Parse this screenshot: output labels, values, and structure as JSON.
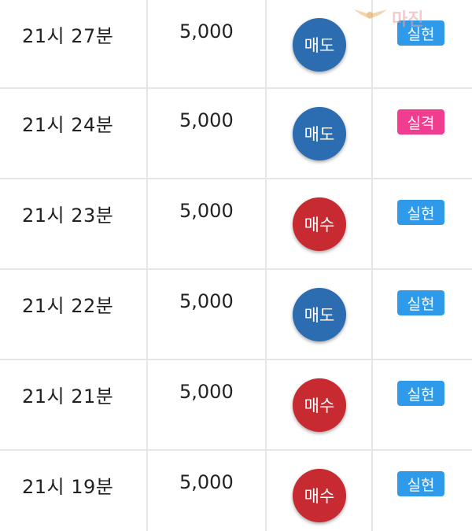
{
  "trades": [
    {
      "time": "21시 27분",
      "amount": "5,000",
      "side": "매도",
      "side_type": "sell",
      "result": "실현",
      "result_type": "real"
    },
    {
      "time": "21시 24분",
      "amount": "5,000",
      "side": "매도",
      "side_type": "sell",
      "result": "실격",
      "result_type": "fail"
    },
    {
      "time": "21시 23분",
      "amount": "5,000",
      "side": "매수",
      "side_type": "buy",
      "result": "실현",
      "result_type": "real"
    },
    {
      "time": "21시 22분",
      "amount": "5,000",
      "side": "매도",
      "side_type": "sell",
      "result": "실현",
      "result_type": "real"
    },
    {
      "time": "21시 21분",
      "amount": "5,000",
      "side": "매수",
      "side_type": "buy",
      "result": "실현",
      "result_type": "real"
    },
    {
      "time": "21시 19분",
      "amount": "5,000",
      "side": "매수",
      "side_type": "buy",
      "result": "실현",
      "result_type": "real"
    }
  ],
  "colors": {
    "sell": "#2b6db0",
    "buy": "#c72a30",
    "real": "#2f9ae9",
    "fail": "#f03d8f"
  },
  "watermark": {
    "logo": "마진",
    "sub": "",
    "icon": "wing-logo-icon"
  }
}
